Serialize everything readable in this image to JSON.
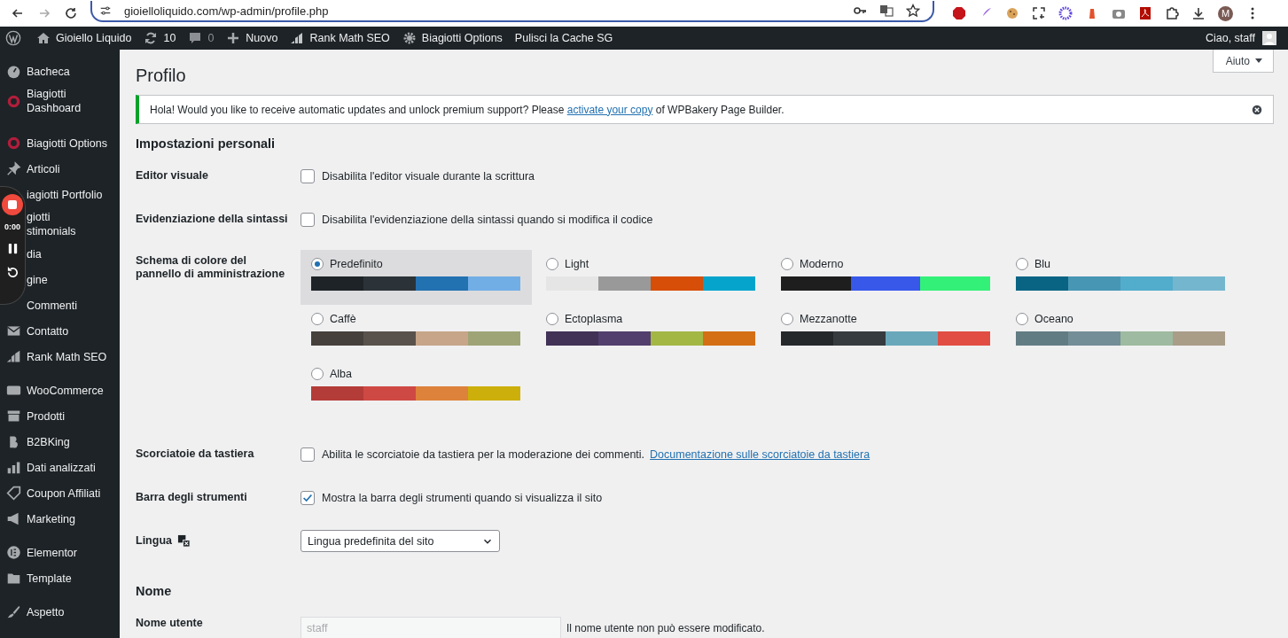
{
  "browser": {
    "url": "gioielloliquido.com/wp-admin/profile.php",
    "profile_initial": "M",
    "forward_disabled": true
  },
  "admin_bar": {
    "site": "Gioiello Liquido",
    "updates": "10",
    "comments": "0",
    "new": "Nuovo",
    "rank_math": "Rank Math SEO",
    "options": "Biagiotti Options",
    "cache": "Pulisci la Cache SG",
    "greeting": "Ciao, staff"
  },
  "sidebar": {
    "groups": [
      [
        {
          "label": "Bacheca"
        },
        {
          "label": "Biagiotti\nDashboard"
        }
      ],
      [
        {
          "label": "Biagiotti Options"
        },
        {
          "label": "Articoli"
        },
        {
          "label": "iagiotti Portfolio"
        },
        {
          "label": "giotti\nstimonials"
        },
        {
          "label": "dia"
        },
        {
          "label": "gine"
        },
        {
          "label": "Commenti"
        },
        {
          "label": "Contatto"
        },
        {
          "label": "Rank Math SEO"
        }
      ],
      [
        {
          "label": "WooCommerce"
        },
        {
          "label": "Prodotti"
        },
        {
          "label": "B2BKing"
        },
        {
          "label": "Dati analizzati"
        },
        {
          "label": "Coupon Affiliati"
        },
        {
          "label": "Marketing"
        }
      ],
      [
        {
          "label": "Elementor"
        },
        {
          "label": "Template"
        }
      ],
      [
        {
          "label": "Aspetto"
        }
      ]
    ]
  },
  "recorder": {
    "time": "0:00"
  },
  "page": {
    "title": "Profilo",
    "help_button": "Aiuto"
  },
  "notice": {
    "before": "Hola! Would you like to receive automatic updates and unlock premium support? Please",
    "link": "activate your copy",
    "after": "of WPBakery Page Builder."
  },
  "sections": [
    {
      "heading": "Impostazioni personali",
      "rows": [
        {
          "kind": "checkbox",
          "label": "Editor visuale",
          "text": "Disabilita l'editor visuale durante la scrittura",
          "checked": false
        },
        {
          "kind": "checkbox",
          "label": "Evidenziazione della sintassi",
          "text": "Disabilita l'evidenziazione della sintassi quando si modifica il codice",
          "checked": false
        },
        {
          "kind": "schemes",
          "label": "Schema di colore del pannello di amministrazione",
          "schemes": [
            {
              "name": "Predefinito",
              "selected": true,
              "swatches": [
                {
                  "color": "#1d2327"
                },
                {
                  "color": "#2c3338"
                },
                {
                  "color": "#2271b1"
                },
                {
                  "color": "#72aee6"
                }
              ]
            },
            {
              "name": "Light",
              "selected": false,
              "swatches": [
                {
                  "color": "#e5e5e5"
                },
                {
                  "color": "#999999"
                },
                {
                  "color": "#d64e07"
                },
                {
                  "color": "#04a4cc"
                }
              ]
            },
            {
              "name": "Moderno",
              "selected": false,
              "swatches": [
                {
                  "color": "#1e1e1e"
                },
                {
                  "color": "#3858e9"
                },
                {
                  "color": "#33f078"
                }
              ]
            },
            {
              "name": "Blu",
              "selected": false,
              "swatches": [
                {
                  "color": "#096484"
                },
                {
                  "color": "#4796b3"
                },
                {
                  "color": "#52accc"
                },
                {
                  "color": "#74b6ce"
                }
              ]
            },
            {
              "name": "Caffè",
              "selected": false,
              "swatches": [
                {
                  "color": "#46403c"
                },
                {
                  "color": "#59524c"
                },
                {
                  "color": "#c7a589"
                },
                {
                  "color": "#9ea476"
                }
              ]
            },
            {
              "name": "Ectoplasma",
              "selected": false,
              "swatches": [
                {
                  "color": "#413256"
                },
                {
                  "color": "#523f6d"
                },
                {
                  "color": "#a3b745"
                },
                {
                  "color": "#d46f15"
                }
              ]
            },
            {
              "name": "Mezzanotte",
              "selected": false,
              "swatches": [
                {
                  "color": "#25282b"
                },
                {
                  "color": "#363b3f"
                },
                {
                  "color": "#69a8bb"
                },
                {
                  "color": "#e14d43"
                }
              ]
            },
            {
              "name": "Oceano",
              "selected": false,
              "swatches": [
                {
                  "color": "#627c83"
                },
                {
                  "color": "#738e96"
                },
                {
                  "color": "#9ebaa0"
                },
                {
                  "color": "#aa9d88"
                }
              ]
            },
            {
              "name": "Alba",
              "selected": false,
              "swatches": [
                {
                  "color": "#b43c38"
                },
                {
                  "color": "#cf4944"
                },
                {
                  "color": "#dd823b"
                },
                {
                  "color": "#ccaf0b"
                }
              ]
            }
          ]
        },
        {
          "kind": "checkbox",
          "label": "Scorciatoie da tastiera",
          "text": "Abilita le scorciatoie da tastiera per la moderazione dei commenti.",
          "link": "Documentazione sulle scorciatoie da tastiera",
          "checked": false
        },
        {
          "kind": "checkbox",
          "label": "Barra degli strumenti",
          "text": "Mostra la barra degli strumenti quando si visualizza il sito",
          "checked": true
        },
        {
          "kind": "select",
          "label": "Lingua",
          "value": "Lingua predefinita del sito"
        }
      ]
    },
    {
      "heading": "Nome",
      "rows": [
        {
          "kind": "text",
          "label": "Nome utente",
          "value": "staff",
          "disabled": true,
          "note": "Il nome utente non può essere modificato."
        }
      ]
    }
  ]
}
